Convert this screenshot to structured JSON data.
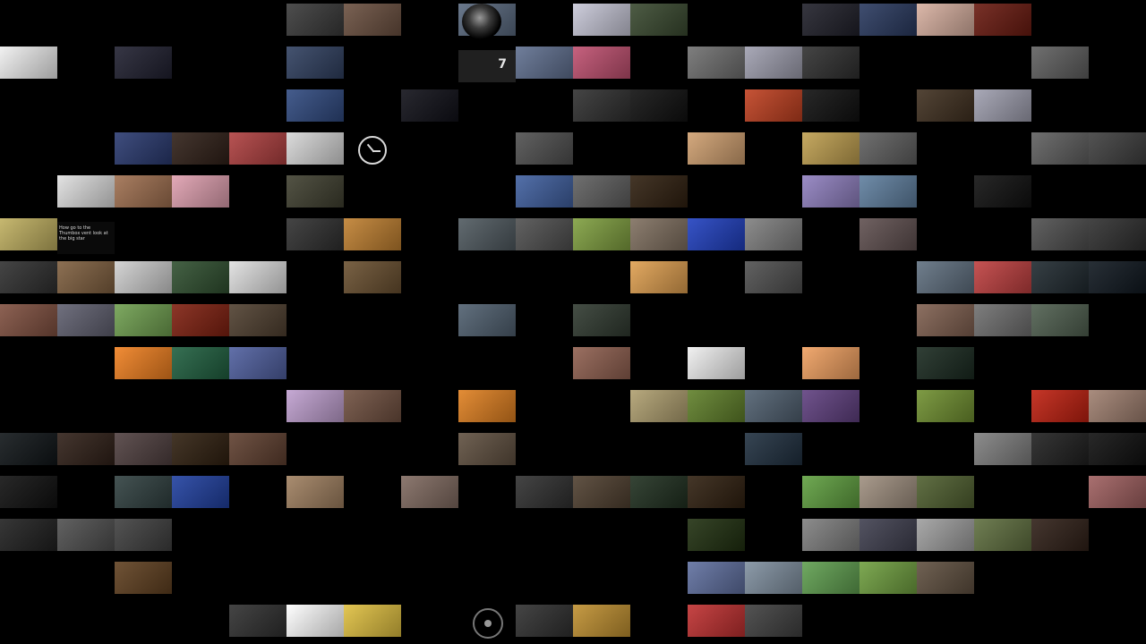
{
  "collage": {
    "tiles": [
      {
        "color": "#3a3a3a"
      },
      {
        "color": "#6b5040"
      },
      {
        "color": "#5a6a80"
      },
      {
        "color": "#c8c8d8"
      },
      {
        "color": "#3a4a30"
      },
      {
        "color": "#20202a"
      },
      {
        "color": "#2a3a60"
      },
      {
        "color": "#d8b0a0"
      },
      {
        "color": "#6a1a10"
      },
      {
        "color": "#f0f0f0"
      },
      {
        "color": "#202030"
      },
      {
        "color": "#304060"
      },
      {
        "color": "#607090"
      },
      {
        "color": "#c05070"
      },
      {
        "color": "#707070"
      },
      {
        "color": "#a0a0b0"
      },
      {
        "color": "#303030"
      },
      {
        "color": "#606060"
      },
      {
        "color": "#304a80"
      },
      {
        "color": "#101018"
      },
      {
        "color": "#303030"
      },
      {
        "color": "#101010"
      },
      {
        "color": "#c04020"
      },
      {
        "color": "#101010"
      },
      {
        "color": "#403020"
      },
      {
        "color": "#a0a0b0"
      },
      {
        "color": "#2a3a70"
      },
      {
        "color": "#302018"
      },
      {
        "color": "#b04040"
      },
      {
        "color": "#d8d8d8"
      },
      {
        "color": "#505050"
      },
      {
        "color": "#d0a070"
      },
      {
        "color": "#c0a050"
      },
      {
        "color": "#606060"
      },
      {
        "color": "#606060"
      },
      {
        "color": "#404040"
      },
      {
        "color": "#e0e0e0"
      },
      {
        "color": "#a07050"
      },
      {
        "color": "#e0a0b0"
      },
      {
        "color": "#404030"
      },
      {
        "color": "#4060a0"
      },
      {
        "color": "#606060"
      },
      {
        "color": "#302010"
      },
      {
        "color": "#9080c0"
      },
      {
        "color": "#6080a0"
      },
      {
        "color": "#101010"
      },
      {
        "color": "#c0b060"
      },
      {
        "color": "#303030"
      },
      {
        "color": "#c08030"
      },
      {
        "color": "#505a60"
      },
      {
        "color": "#505050"
      },
      {
        "color": "#80a040"
      },
      {
        "color": "#807060"
      },
      {
        "color": "#2040c0"
      },
      {
        "color": "#808080"
      },
      {
        "color": "#605050"
      },
      {
        "color": "#505050"
      },
      {
        "color": "#303030"
      },
      {
        "color": "#303030"
      },
      {
        "color": "#806040"
      },
      {
        "color": "#d0d0d0"
      },
      {
        "color": "#305030"
      },
      {
        "color": "#e0e0e0"
      },
      {
        "color": "#6a5030"
      },
      {
        "color": "#e0a050"
      },
      {
        "color": "#505050"
      },
      {
        "color": "#607080"
      },
      {
        "color": "#c04040"
      },
      {
        "color": "#202a30"
      },
      {
        "color": "#101820"
      },
      {
        "color": "#805040"
      },
      {
        "color": "#606070"
      },
      {
        "color": "#70a050"
      },
      {
        "color": "#802010"
      },
      {
        "color": "#504030"
      },
      {
        "color": "#506070"
      },
      {
        "color": "#303a30"
      },
      {
        "color": "#806050"
      },
      {
        "color": "#707070"
      },
      {
        "color": "#506050"
      },
      {
        "color": "#f08020"
      },
      {
        "color": "#206040"
      },
      {
        "color": "#5060a0"
      },
      {
        "color": "#906050"
      },
      {
        "color": "#f0f0f0"
      },
      {
        "color": "#f0a060"
      },
      {
        "color": "#1a2a20"
      },
      {
        "color": "#c0a0d0"
      },
      {
        "color": "#705040"
      },
      {
        "color": "#e08020"
      },
      {
        "color": "#b0a070"
      },
      {
        "color": "#60802a"
      },
      {
        "color": "#506070"
      },
      {
        "color": "#604080"
      },
      {
        "color": "#709030"
      },
      {
        "color": "#c02010"
      },
      {
        "color": "#a08070"
      },
      {
        "color": "#101518"
      },
      {
        "color": "#302018"
      },
      {
        "color": "#504040"
      },
      {
        "color": "#302010"
      },
      {
        "color": "#604030"
      },
      {
        "color": "#605040"
      },
      {
        "color": "#203040"
      },
      {
        "color": "#808080"
      },
      {
        "color": "#202020"
      },
      {
        "color": "#101010"
      },
      {
        "color": "#101010"
      },
      {
        "color": "#304040"
      },
      {
        "color": "#2040a0"
      },
      {
        "color": "#a08060"
      },
      {
        "color": "#806a60"
      },
      {
        "color": "#303030"
      },
      {
        "color": "#504030"
      },
      {
        "color": "#203020"
      },
      {
        "color": "#302010"
      },
      {
        "color": "#60a040"
      },
      {
        "color": "#a09080"
      },
      {
        "color": "#506030"
      },
      {
        "color": "#a06060"
      },
      {
        "color": "#202020"
      },
      {
        "color": "#505050"
      },
      {
        "color": "#404040"
      },
      {
        "color": "#203010"
      },
      {
        "color": "#808080"
      },
      {
        "color": "#404050"
      },
      {
        "color": "#a0a0a0"
      },
      {
        "color": "#607040"
      },
      {
        "color": "#302018"
      },
      {
        "color": "#604020"
      },
      {
        "color": "#6070a0"
      },
      {
        "color": "#8090a0"
      },
      {
        "color": "#60a050"
      },
      {
        "color": "#70a040"
      },
      {
        "color": "#605040"
      },
      {
        "color": "#303030"
      },
      {
        "color": "#ffffff"
      },
      {
        "color": "#e0c040"
      },
      {
        "color": "#303030"
      },
      {
        "color": "#c09030"
      },
      {
        "color": "#c03030"
      },
      {
        "color": "#404040"
      },
      {
        "color": "#606060"
      },
      {
        "color": "#404040"
      }
    ],
    "tile_text": {
      "handwritten_note": "How go to the Thumbox vent look at the big star",
      "counter_value": "7"
    }
  }
}
